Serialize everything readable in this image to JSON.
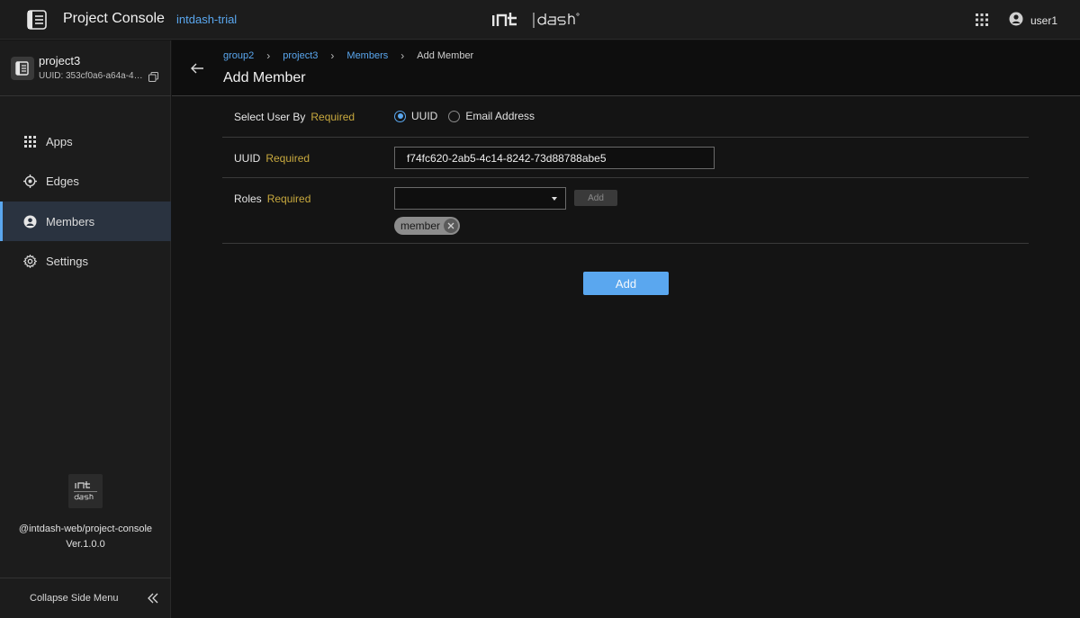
{
  "header": {
    "app_title": "Project Console",
    "org_name": "intdash-trial",
    "brand": "intdash",
    "user_name": "user1"
  },
  "sidebar": {
    "project_name": "project3",
    "project_uuid": "UUID: 353cf0a6-a64a-4…",
    "items": [
      {
        "label": "Apps",
        "icon": "apps-grid-icon",
        "active": false
      },
      {
        "label": "Edges",
        "icon": "edge-icon",
        "active": false
      },
      {
        "label": "Members",
        "icon": "person-icon",
        "active": true
      },
      {
        "label": "Settings",
        "icon": "gear-icon",
        "active": false
      }
    ],
    "footer_logo": "int dash",
    "package_name": "@intdash-web/project-console",
    "version": "Ver.1.0.0",
    "collapse_label": "Collapse Side Menu"
  },
  "breadcrumb": {
    "items": [
      "group2",
      "project3",
      "Members"
    ],
    "current": "Add Member"
  },
  "page": {
    "title": "Add Member"
  },
  "form": {
    "required_text": "Required",
    "select_user_by": {
      "label": "Select User By",
      "options": [
        "UUID",
        "Email Address"
      ],
      "selected": "UUID"
    },
    "uuid": {
      "label": "UUID",
      "value": "f74fc620-2ab5-4c14-8242-73d88788abe5"
    },
    "roles": {
      "label": "Roles",
      "selected_value": "",
      "add_label": "Add",
      "chips": [
        "member"
      ]
    },
    "submit_label": "Add"
  },
  "colors": {
    "accent": "#5aa7ef",
    "required": "#c8a93e",
    "background": "#141414"
  }
}
